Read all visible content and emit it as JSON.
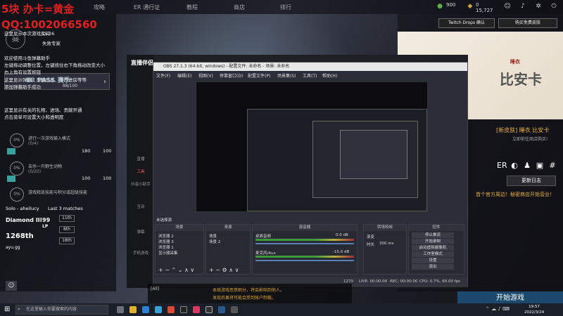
{
  "overlay": {
    "line1": "5块 办卡=黄金",
    "line2": "QQ:1002066560"
  },
  "topnav": {
    "items": [
      "攻略",
      "ER 通行证",
      "教程",
      "商店",
      "排行"
    ]
  },
  "resources": {
    "coins": "900",
    "currency2": "0",
    "currency3": "15,727"
  },
  "left": {
    "profile_level": "Lv.26",
    "profile_title": "失败专家",
    "pass_label": "ER PASS 赛季",
    "pass_progress": "88/100",
    "msgs": [
      "这里显示本次游戏房间",
      "欢迎使用斗鱼弹幕助手",
      "左键拖动调整位置，左键按住右下角拖动改变大小",
      "右上角有设置按钮",
      "这里显示弹幕、贡献信息、用户进房等等",
      "添加弹幕助手成功",
      "这里显示有关的礼物、进场、贡献开通",
      "点击菜单可设置大小和透明度"
    ],
    "quests": [
      {
        "title": "进行一次游戏输入模式",
        "prog": "(0/4)",
        "a": "180",
        "b": "100"
      },
      {
        "title": "击杀一只野生动物",
        "prog": "(0/20)",
        "a": "100",
        "b": "100"
      },
      {
        "title": "游戏释放技能与积分或超级技能",
        "prog": "",
        "a": "",
        "b": ""
      }
    ],
    "rank": {
      "mode": "Solo - aheilucy",
      "last": "Last 3 matches",
      "tier": "Diamond III",
      "lp": "99",
      "lp_unit": "LP",
      "pos": "1268th",
      "user": "ayu.gg",
      "pills": [
        "11th",
        "8th",
        "18th"
      ]
    }
  },
  "right": {
    "twitch_btn": "Twitch Drops 确认",
    "buy_btn": "购买免费皮肤",
    "promo_small": "睡衣",
    "promo_big": "比安卡",
    "skin_title": "[新皮肤] 睡衣 比安卡",
    "skin_sub": "立即前往商店购买!",
    "icons": [
      "ER",
      "微信",
      "QQ",
      "B站",
      "#"
    ],
    "update_btn": "更新日志",
    "update_text": "首个官方周边！秘密商店开始营业！",
    "start_btn": "开始游戏"
  },
  "douyin": {
    "title": "直播伴侣",
    "side": [
      "直播",
      "工具",
      "抖音小助手",
      "互动",
      "弹幕",
      "手机游戏"
    ]
  },
  "obs": {
    "title": "OBS 27.1.3 (64-bit, windows) - 配置文件: 未命名 - 场景: 未命名",
    "menu": [
      "文件(F)",
      "编辑(E)",
      "视图(V)",
      "停靠窗口(D)",
      "配置文件(P)",
      "场景集(S)",
      "工具(T)",
      "帮助(H)"
    ],
    "source_tab": "未选择源",
    "docks": {
      "scenes": "场景",
      "sources": "来源",
      "mixer": "混音器",
      "transitions": "转场特效",
      "controls": "控件"
    },
    "scenes": [
      "浏览器 2",
      "浏览器 3",
      "浏览器 1",
      "显示器采集"
    ],
    "sources": [
      "场景",
      "场景 2"
    ],
    "mixer": [
      {
        "name": "桌面音频",
        "db": "0.0 dB"
      },
      {
        "name": "麦克风/Aux",
        "db": "-15.0 dB"
      }
    ],
    "transition": {
      "label": "渐变",
      "dur_label": "时长",
      "dur": "300 ms"
    },
    "controls": [
      "停止推流",
      "开始录制",
      "启动虚拟摄像机",
      "工作室模式",
      "设置",
      "退出"
    ],
    "status": {
      "live": "LIVE: 00:00:00",
      "rec": "REC: 00:00:00",
      "cpu": "CPU: 0.7%, 60.00 fps",
      "res": "1270"
    }
  },
  "chat": {
    "tag": "[All]",
    "l1": "本局游戏恶意刷分，将会影响到他人。",
    "l2": "发现后果将可能会受到账户制裁。"
  },
  "taskbar": {
    "search": "在这里输入你要搜索的内容",
    "time": "19:57",
    "date": "2022/3/24"
  }
}
